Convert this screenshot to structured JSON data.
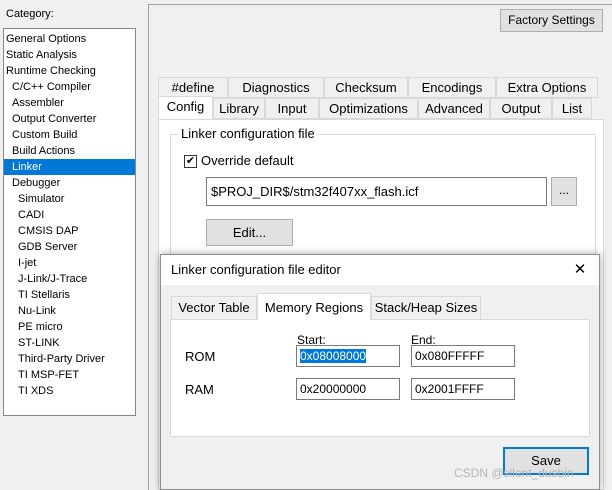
{
  "category": {
    "label": "Category:",
    "items": [
      {
        "label": "General Options",
        "indent": 0
      },
      {
        "label": "Static Analysis",
        "indent": 0
      },
      {
        "label": "Runtime Checking",
        "indent": 0
      },
      {
        "label": "C/C++ Compiler",
        "indent": 1
      },
      {
        "label": "Assembler",
        "indent": 1
      },
      {
        "label": "Output Converter",
        "indent": 1
      },
      {
        "label": "Custom Build",
        "indent": 1
      },
      {
        "label": "Build Actions",
        "indent": 1
      },
      {
        "label": "Linker",
        "indent": 1,
        "selected": true
      },
      {
        "label": "Debugger",
        "indent": 1
      },
      {
        "label": "Simulator",
        "indent": 2
      },
      {
        "label": "CADI",
        "indent": 2
      },
      {
        "label": "CMSIS DAP",
        "indent": 2
      },
      {
        "label": "GDB Server",
        "indent": 2
      },
      {
        "label": "I-jet",
        "indent": 2
      },
      {
        "label": "J-Link/J-Trace",
        "indent": 2
      },
      {
        "label": "TI Stellaris",
        "indent": 2
      },
      {
        "label": "Nu-Link",
        "indent": 2
      },
      {
        "label": "PE micro",
        "indent": 2
      },
      {
        "label": "ST-LINK",
        "indent": 2
      },
      {
        "label": "Third-Party Driver",
        "indent": 2
      },
      {
        "label": "TI MSP-FET",
        "indent": 2
      },
      {
        "label": "TI XDS",
        "indent": 2
      }
    ]
  },
  "toolbar": {
    "factory_settings_label": "Factory Settings"
  },
  "tabs_row1": [
    "#define",
    "Diagnostics",
    "Checksum",
    "Encodings",
    "Extra Options"
  ],
  "tabs_row2": [
    "Config",
    "Library",
    "Input",
    "Optimizations",
    "Advanced",
    "Output",
    "List"
  ],
  "active_tab": "Config",
  "config": {
    "group_title": "Linker configuration file",
    "override_label": "Override default",
    "override_checked": true,
    "icf_path": "$PROJ_DIR$/stm32f407xx_flash.icf",
    "browse_label": "...",
    "edit_label": "Edit..."
  },
  "dialog": {
    "title": "Linker configuration file editor",
    "close_glyph": "✕",
    "tabs": [
      "Vector Table",
      "Memory Regions",
      "Stack/Heap Sizes"
    ],
    "active_tab": "Memory Regions",
    "columns": {
      "start": "Start:",
      "end": "End:"
    },
    "regions": [
      {
        "name": "ROM",
        "start": "0x08008000",
        "end": "0x080FFFFF"
      },
      {
        "name": "RAM",
        "start": "0x20000000",
        "end": "0x2001FFFF"
      }
    ],
    "save_label": "Save"
  },
  "watermark": "CSDN @silent_dusbin",
  "colors": {
    "selection": "#0078d7",
    "accent_border": "#0078d7"
  }
}
